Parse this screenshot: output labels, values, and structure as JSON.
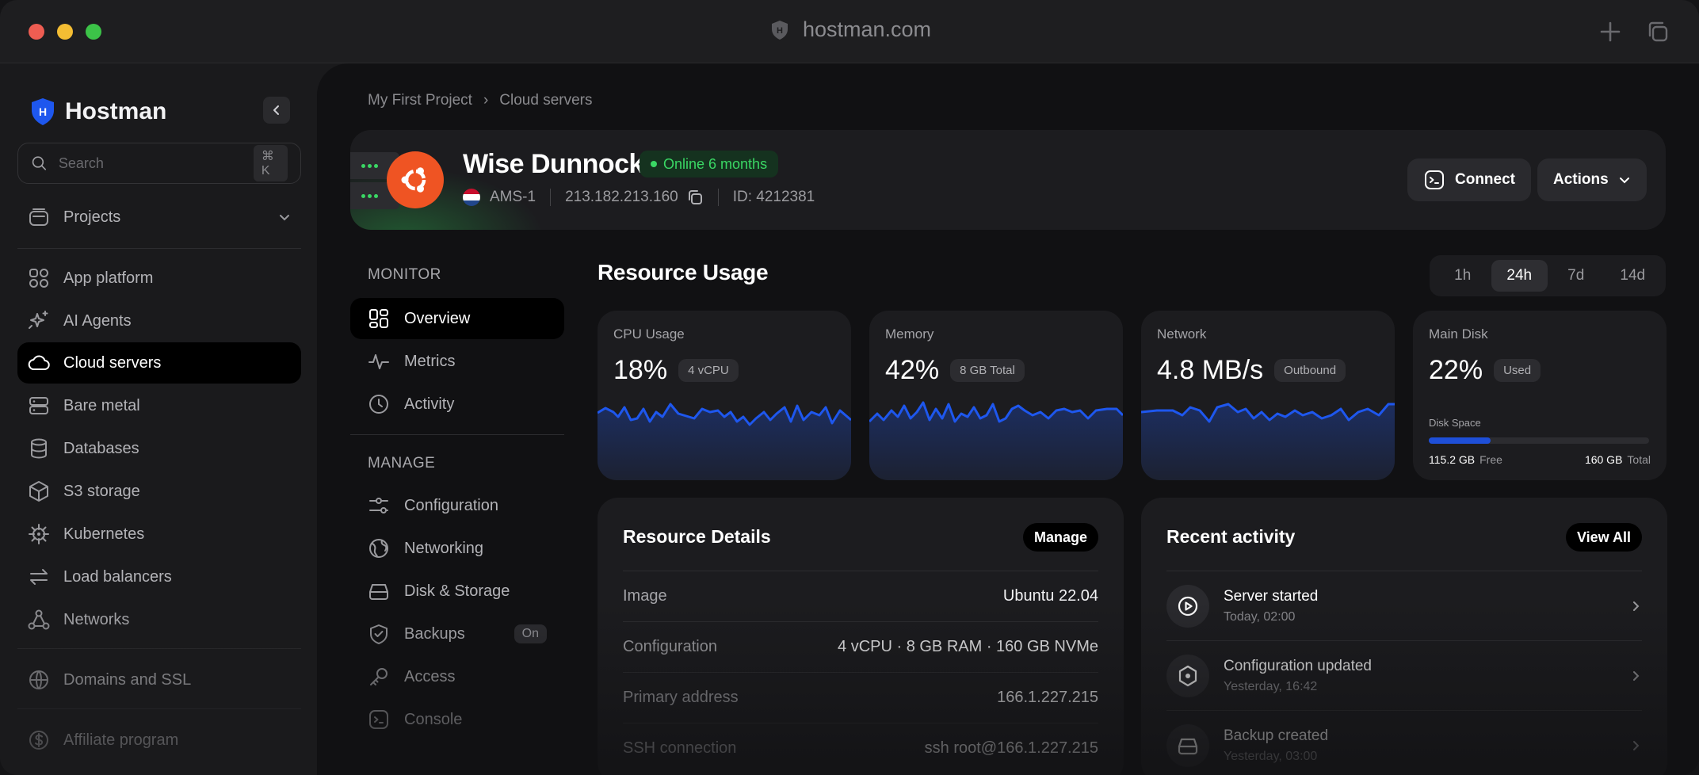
{
  "browser": {
    "url": "hostman.com",
    "traffic_lights": [
      "#ee5d52",
      "#f4bd33",
      "#3cc348"
    ]
  },
  "sidebar": {
    "brand": "Hostman",
    "logo_letter": "H",
    "search_placeholder": "Search",
    "search_shortcut": "⌘ K",
    "projects_label": "Projects",
    "items": [
      {
        "label": "App platform",
        "icon": "app-grid-icon"
      },
      {
        "label": "AI Agents",
        "icon": "sparkles-icon"
      },
      {
        "label": "Cloud servers",
        "icon": "cloud-icon",
        "active": true
      },
      {
        "label": "Bare metal",
        "icon": "server-icon"
      },
      {
        "label": "Databases",
        "icon": "database-icon"
      },
      {
        "label": "S3 storage",
        "icon": "cube-icon"
      },
      {
        "label": "Kubernetes",
        "icon": "helm-icon"
      },
      {
        "label": "Load balancers",
        "icon": "arrows-icon"
      },
      {
        "label": "Networks",
        "icon": "network-icon"
      },
      {
        "label": "Domains and SSL",
        "icon": "globe-icon"
      },
      {
        "label": "Affiliate program",
        "icon": "dollar-icon"
      }
    ]
  },
  "breadcrumb": {
    "project": "My First Project",
    "separator": "›",
    "current": "Cloud servers"
  },
  "server": {
    "name": "Wise Dunnock",
    "status": "Online 6 months",
    "region": "AMS-1",
    "ip": "213.182.213.160",
    "id": "ID: 4212381",
    "connect_label": "Connect",
    "actions_label": "Actions",
    "os_color": "#ef5423",
    "status_color": "#3ad764"
  },
  "monitor": {
    "heading": "MONITOR",
    "items": [
      {
        "label": "Overview",
        "icon": "overview-icon",
        "active": true
      },
      {
        "label": "Metrics",
        "icon": "pulse-icon"
      },
      {
        "label": "Activity",
        "icon": "clock-icon"
      }
    ]
  },
  "manage": {
    "heading": "MANAGE",
    "items": [
      {
        "label": "Configuration",
        "icon": "sliders-icon"
      },
      {
        "label": "Networking",
        "icon": "globe-icon"
      },
      {
        "label": "Disk & Storage",
        "icon": "disk-icon"
      },
      {
        "label": "Backups",
        "icon": "shield-check-icon",
        "badge": "On"
      },
      {
        "label": "Access",
        "icon": "key-icon"
      },
      {
        "label": "Console",
        "icon": "terminal-icon"
      }
    ]
  },
  "resource_usage": {
    "title": "Resource Usage",
    "ranges": [
      "1h",
      "24h",
      "7d",
      "14d"
    ],
    "active_range": "24h",
    "cards": [
      {
        "label": "CPU Usage",
        "value": "18%",
        "pill": "4 vCPU"
      },
      {
        "label": "Memory",
        "value": "42%",
        "pill": "8 GB Total"
      },
      {
        "label": "Network",
        "value": "4.8 MB/s",
        "pill": "Outbound"
      },
      {
        "label": "Main Disk",
        "value": "22%",
        "pill": "Used"
      }
    ],
    "disk": {
      "label": "Disk Space",
      "used_fraction": 0.28,
      "free": "115.2 GB",
      "free_label": "Free",
      "total": "160 GB",
      "total_label": "Total"
    },
    "accent": "#1e4fd8"
  },
  "resource_details": {
    "title": "Resource Details",
    "button": "Manage",
    "rows": [
      {
        "key": "Image",
        "value": "Ubuntu 22.04"
      },
      {
        "key": "Configuration",
        "value": "4 vCPU · 8 GB RAM · 160 GB NVMe"
      },
      {
        "key": "Primary address",
        "value": "166.1.227.215"
      },
      {
        "key": "SSH connection",
        "value": "ssh root@166.1.227.215"
      }
    ]
  },
  "recent_activity": {
    "title": "Recent activity",
    "button": "View All",
    "items": [
      {
        "title": "Server started",
        "time": "Today, 02:00",
        "icon": "play-icon"
      },
      {
        "title": "Configuration updated",
        "time": "Yesterday, 16:42",
        "icon": "hexagon-icon"
      },
      {
        "title": "Backup created",
        "time": "Yesterday, 03:00",
        "icon": "disk-icon"
      }
    ]
  }
}
